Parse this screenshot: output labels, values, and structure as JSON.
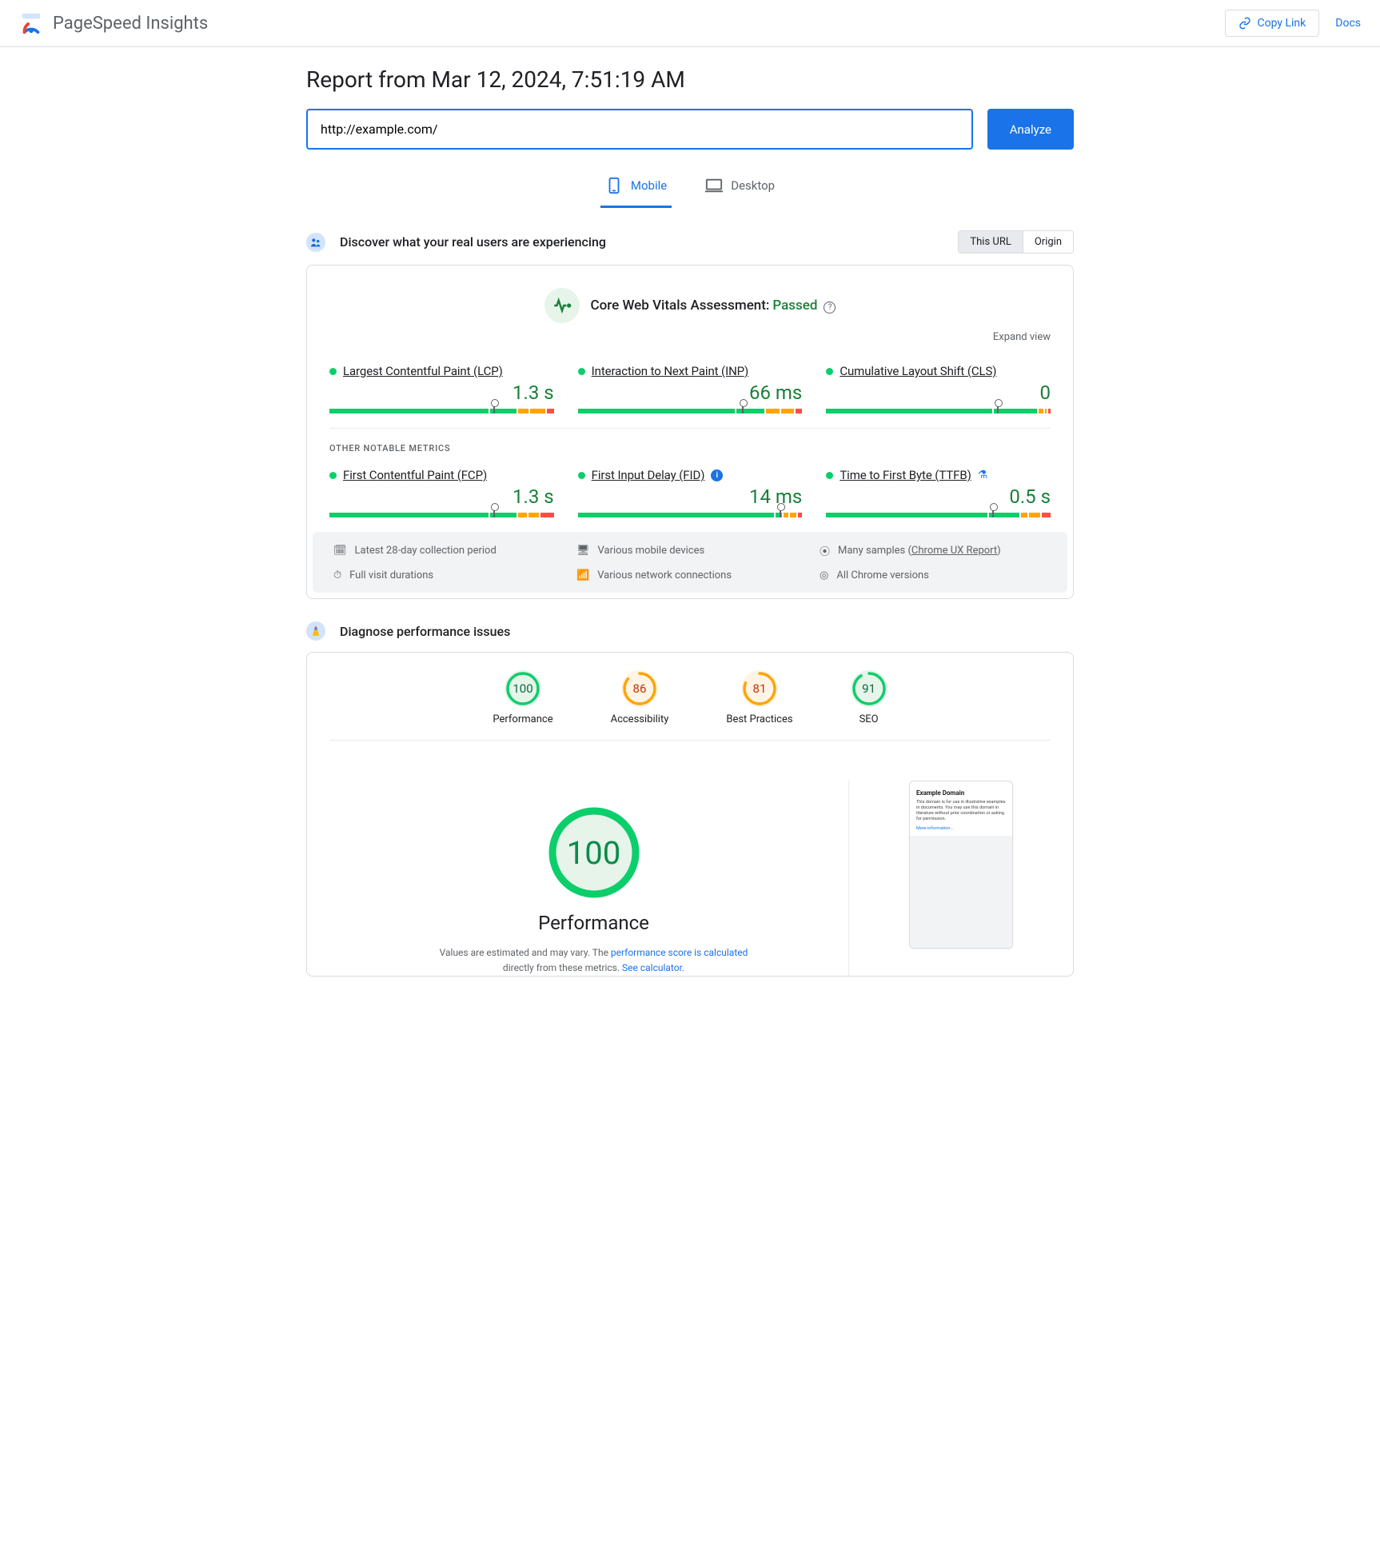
{
  "header": {
    "product_name": "PageSpeed Insights",
    "copy_link_label": "Copy Link",
    "docs_label": "Docs"
  },
  "report": {
    "title": "Report from Mar 12, 2024, 7:51:19 AM",
    "url_value": "http://example.com/",
    "analyze_label": "Analyze"
  },
  "tabs": {
    "mobile": "Mobile",
    "desktop": "Desktop"
  },
  "crux": {
    "section_title": "Discover what your real users are experiencing",
    "toggle_this_url": "This URL",
    "toggle_origin": "Origin",
    "cwv_title_prefix": "Core Web Vitals Assessment:",
    "cwv_status": "Passed",
    "expand_label": "Expand view",
    "other_label": "OTHER NOTABLE METRICS",
    "metrics": {
      "lcp": {
        "name": "Largest Contentful Paint (LCP)",
        "value": "1.3 s",
        "dist": [
          73,
          12,
          5,
          7,
          3
        ],
        "marker": 73
      },
      "inp": {
        "name": "Interaction to Next Paint (INP)",
        "value": "66 ms",
        "dist": [
          72,
          13,
          6,
          6,
          3
        ],
        "marker": 73
      },
      "cls": {
        "name": "Cumulative Layout Shift (CLS)",
        "value": "0",
        "dist": [
          76,
          20,
          2,
          1,
          1
        ],
        "marker": 76
      },
      "fcp": {
        "name": "First Contentful Paint (FCP)",
        "value": "1.3 s",
        "dist": [
          73,
          12,
          4,
          5,
          6
        ],
        "marker": 73
      },
      "fid": {
        "name": "First Input Delay (FID)",
        "value": "14 ms",
        "dist": [
          90,
          3,
          2,
          3,
          2
        ],
        "marker": 90
      },
      "ttfb": {
        "name": "Time to First Byte (TTFB)",
        "value": "0.5 s",
        "dist": [
          74,
          14,
          3,
          5,
          4
        ],
        "marker": 74
      }
    },
    "footer": {
      "collection_period": "Latest 28-day collection period",
      "devices": "Various mobile devices",
      "samples_prefix": "Many samples (",
      "samples_link": "Chrome UX Report",
      "samples_suffix": ")",
      "durations": "Full visit durations",
      "connections": "Various network connections",
      "versions": "All Chrome versions"
    }
  },
  "lighthouse": {
    "section_title": "Diagnose performance issues",
    "gauges": {
      "performance": {
        "value": "100",
        "label": "Performance",
        "color": "#0cce6b",
        "bg": "#e6f4ea",
        "txt": "#0c6b3d",
        "pct": 100
      },
      "accessibility": {
        "value": "86",
        "label": "Accessibility",
        "color": "#ffa400",
        "bg": "#fff4e5",
        "txt": "#c33300",
        "pct": 86
      },
      "best": {
        "value": "81",
        "label": "Best Practices",
        "color": "#ffa400",
        "bg": "#fff4e5",
        "txt": "#c33300",
        "pct": 81
      },
      "seo": {
        "value": "91",
        "label": "SEO",
        "color": "#0cce6b",
        "bg": "#e6f4ea",
        "txt": "#0c6b3d",
        "pct": 91
      }
    },
    "big": {
      "value": "100",
      "title": "Performance",
      "desc_prefix": "Values are estimated and may vary. The ",
      "desc_link1": "performance score is calculated",
      "desc_middle": " directly from these metrics. ",
      "desc_link2": "See calculator."
    },
    "preview": {
      "title": "Example Domain",
      "text": "This domain is for use in illustrative examples in documents. You may use this domain in literature without prior coordination or asking for permission.",
      "more": "More information..."
    }
  }
}
